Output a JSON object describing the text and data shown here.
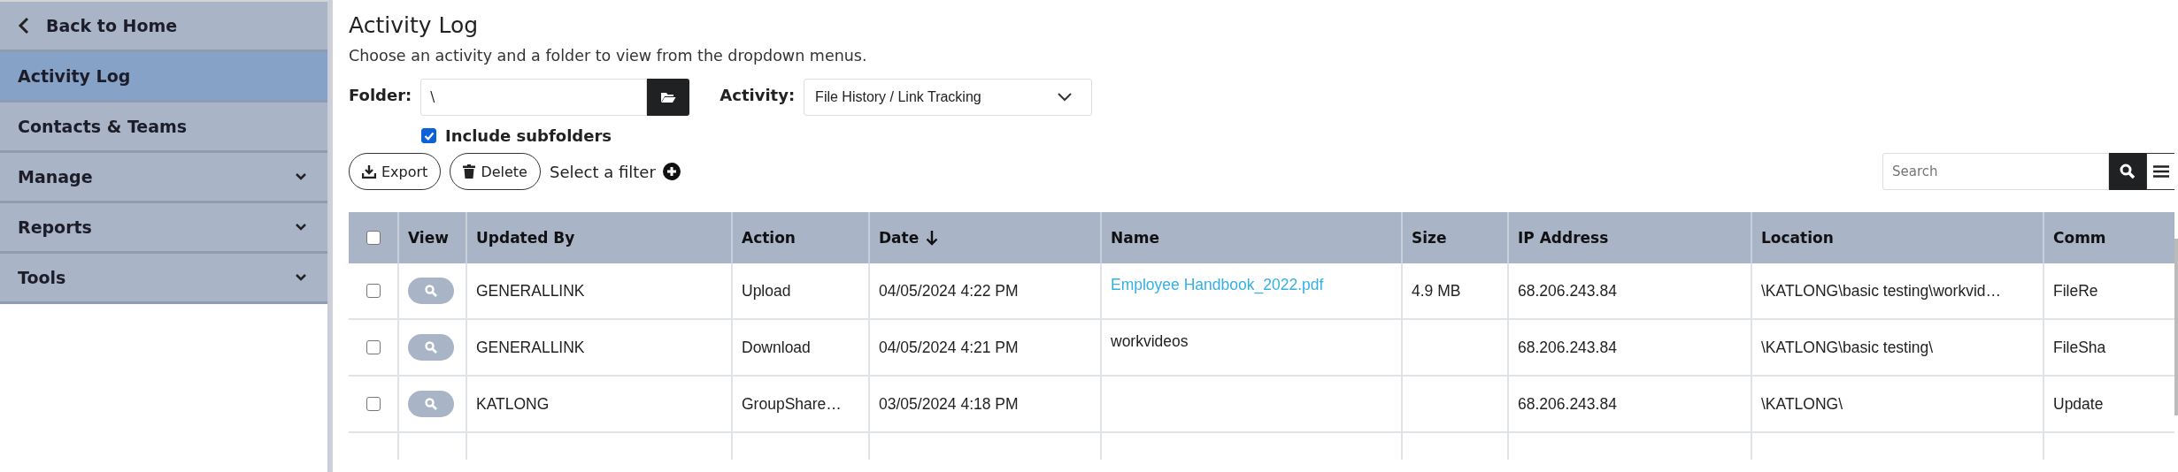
{
  "sidebar": {
    "back": {
      "label": "Back to Home"
    },
    "items": [
      {
        "label": "Activity Log",
        "selected": true,
        "expandable": false
      },
      {
        "label": "Contacts & Teams",
        "selected": false,
        "expandable": false
      },
      {
        "label": "Manage",
        "selected": false,
        "expandable": true
      },
      {
        "label": "Reports",
        "selected": false,
        "expandable": true
      },
      {
        "label": "Tools",
        "selected": false,
        "expandable": true
      }
    ]
  },
  "page": {
    "title": "Activity Log",
    "description": "Choose an activity and a folder to view from the dropdown menus."
  },
  "filters": {
    "folder": {
      "label": "Folder:",
      "value": "\\"
    },
    "activity": {
      "label": "Activity:",
      "value": "File History / Link Tracking"
    },
    "include_subfolders": {
      "label": "Include subfolders",
      "checked": true
    }
  },
  "toolbar": {
    "export": "Export",
    "delete": "Delete",
    "filter": "Select a filter",
    "search": {
      "placeholder": "Search"
    }
  },
  "table": {
    "select_all": {
      "checked": false
    },
    "columns": [
      {
        "label": "View",
        "sorted": false
      },
      {
        "label": "Updated By",
        "sorted": false
      },
      {
        "label": "Action",
        "sorted": false
      },
      {
        "label": "Date",
        "sorted": true
      },
      {
        "label": "Name",
        "sorted": false
      },
      {
        "label": "Size",
        "sorted": false
      },
      {
        "label": "IP Address",
        "sorted": false
      },
      {
        "label": "Location",
        "sorted": false
      },
      {
        "label": "Comm",
        "sorted": false
      }
    ],
    "rows": [
      {
        "checked": false,
        "updated_by": "GENERALLINK",
        "action": "Upload",
        "date": "04/05/2024 4:22 PM",
        "name": {
          "text": "Employee Handbook_2022.pdf",
          "link": true
        },
        "size": "4.9 MB",
        "ip": "68.206.243.84",
        "location": "\\KATLONG\\basic testing\\workvid…",
        "column_9": "FileRe"
      },
      {
        "checked": false,
        "updated_by": "GENERALLINK",
        "action": "Download",
        "date": "04/05/2024 4:21 PM",
        "name": {
          "text": "workvideos",
          "link": false
        },
        "ip": "68.206.243.84",
        "location": "\\KATLONG\\basic testing\\",
        "column_9": "FileSha"
      },
      {
        "checked": false,
        "updated_by": "KATLONG",
        "action": "GroupShare…",
        "date": "03/05/2024 4:18 PM",
        "ip": "68.206.243.84",
        "location": "\\KATLONG\\",
        "column_9": "Update"
      }
    ]
  }
}
